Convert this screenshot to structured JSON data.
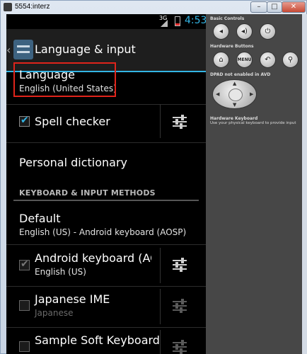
{
  "window": {
    "title": "5554:interz",
    "buttons": {
      "minimize": "–",
      "maximize": "□",
      "close": "✕"
    }
  },
  "statusbar": {
    "network": "3G",
    "time": "4:53"
  },
  "actionbar": {
    "title": "Language & input"
  },
  "rows": {
    "language": {
      "title": "Language",
      "subtitle": "English (United States)"
    },
    "spell_checker": {
      "title": "Spell checker",
      "checked": true
    },
    "personal_dictionary": {
      "title": "Personal dictionary"
    },
    "section_header": "KEYBOARD & INPUT METHODS",
    "default": {
      "title": "Default",
      "subtitle": "English (US) - Android keyboard (AOSP)"
    },
    "android_keyboard": {
      "title": "Android keyboard (AOSP",
      "subtitle": "English (US)",
      "checked": true
    },
    "japanese_ime": {
      "title": "Japanese IME",
      "subtitle": "Japanese",
      "checked": false
    },
    "sample_soft_keyboard": {
      "title": "Sample Soft Keyboard",
      "checked": false
    }
  },
  "panel": {
    "basic_controls": "Basic Controls",
    "hardware_buttons": "Hardware Buttons",
    "menu_label": "MENU",
    "dpad_note": "DPAD not enabled in AVD",
    "hardware_keyboard_title": "Hardware Keyboard",
    "hardware_keyboard_desc": "Use your physical keyboard to provide input"
  },
  "colors": {
    "accent": "#33b5e5",
    "highlight": "#e0241b",
    "screen_bg": "#000000",
    "panel_bg": "#474747"
  },
  "icons": {
    "volume_down": "volume-down-icon",
    "volume_up": "volume-up-icon",
    "power": "power-icon",
    "home": "home-icon",
    "back": "back-icon",
    "search": "search-icon"
  }
}
